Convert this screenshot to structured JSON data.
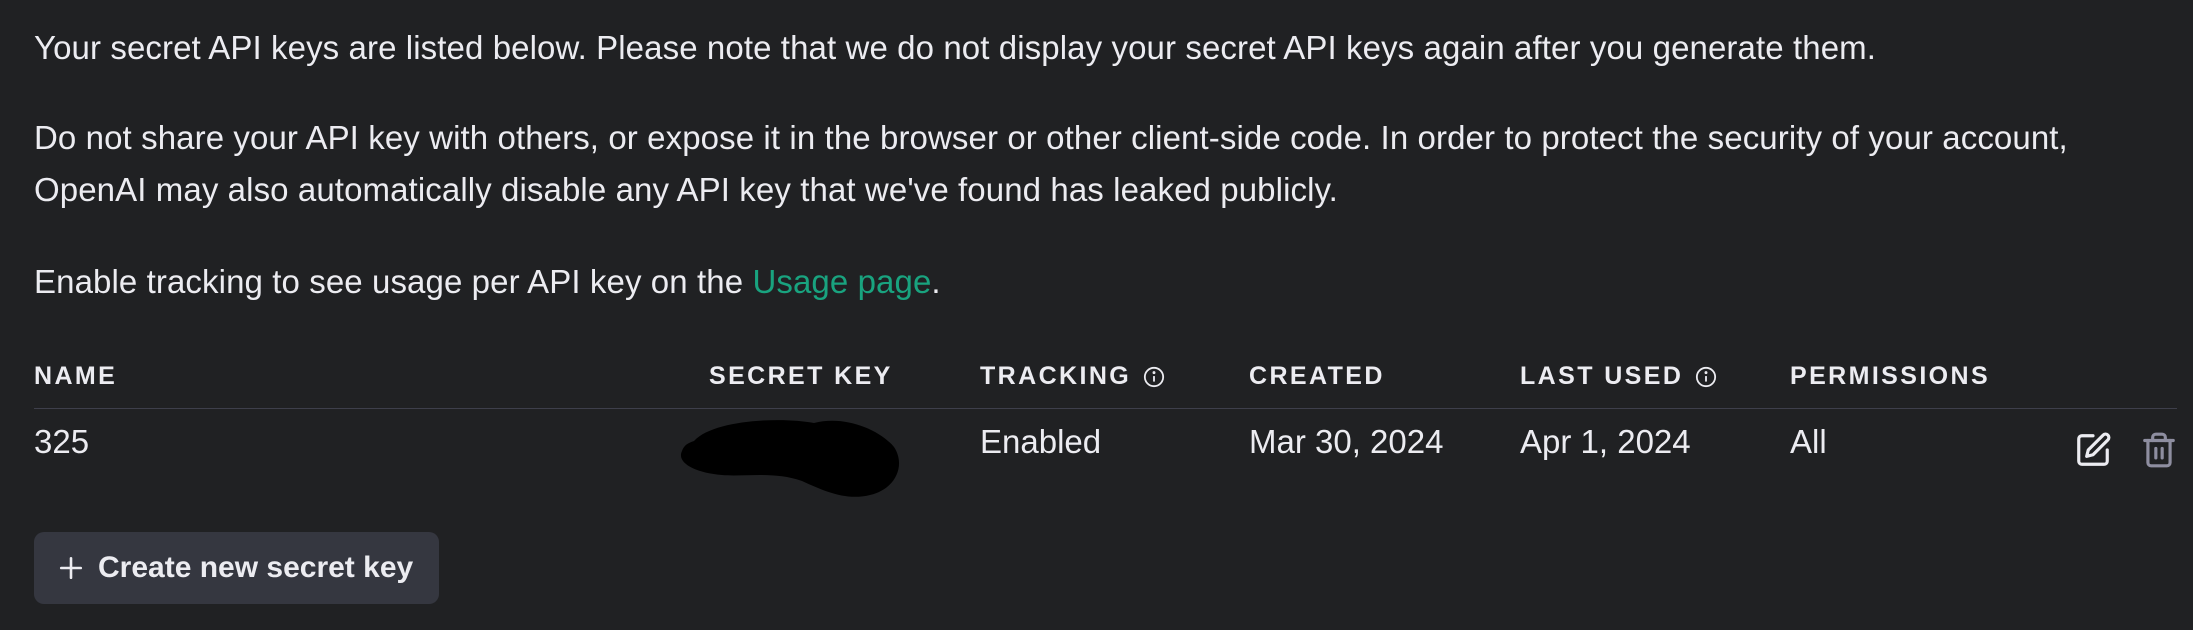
{
  "intro": {
    "line1": "Your secret API keys are listed below. Please note that we do not display your secret API keys again after you generate them.",
    "line2": "Do not share your API key with others, or expose it in the browser or other client-side code. In order to protect the security of your account, OpenAI may also automatically disable any API key that we've found has leaked publicly.",
    "line3_prefix": "Enable tracking to see usage per API key on the ",
    "line3_link": "Usage page",
    "line3_suffix": "."
  },
  "table": {
    "headers": {
      "name": "NAME",
      "secret_key": "SECRET KEY",
      "tracking": "TRACKING",
      "created": "CREATED",
      "last_used": "LAST USED",
      "permissions": "PERMISSIONS"
    },
    "rows": [
      {
        "name": "325",
        "secret_key": "",
        "tracking": "Enabled",
        "created": "Mar 30, 2024",
        "last_used": "Apr 1, 2024",
        "permissions": "All"
      }
    ]
  },
  "create_button": {
    "label": "Create new secret key",
    "icon": "plus-icon"
  },
  "icons": {
    "info": "info-icon",
    "edit": "edit-icon",
    "delete": "trash-icon"
  },
  "colors": {
    "background": "#202123",
    "text": "#ececf1",
    "link": "#19a37f",
    "button_bg": "#353740",
    "divider": "#3e3f4b"
  }
}
